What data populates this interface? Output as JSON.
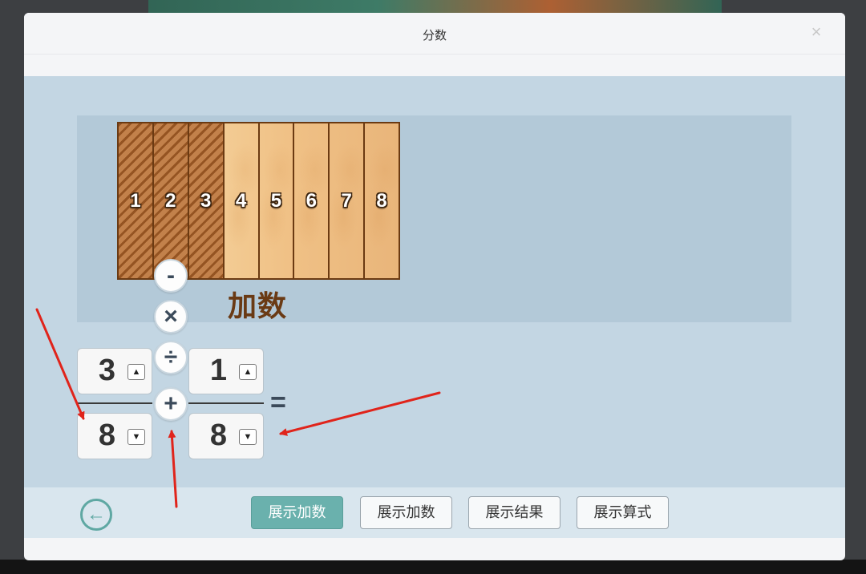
{
  "modal": {
    "title": "分数",
    "close_glyph": "×"
  },
  "bar": {
    "segments": [
      "1",
      "2",
      "3",
      "4",
      "5",
      "6",
      "7",
      "8"
    ],
    "shaded_count": 3,
    "label": "加数"
  },
  "operators": {
    "minus": "-",
    "times": "×",
    "divide": "÷",
    "plus": "+"
  },
  "fraction_left": {
    "numerator": "3",
    "denominator": "8"
  },
  "fraction_right": {
    "numerator": "1",
    "denominator": "8"
  },
  "spinner": {
    "up": "▲",
    "down": "▼"
  },
  "equals": "=",
  "footer": {
    "back_glyph": "←",
    "buttons": [
      "展示加数",
      "展示加数",
      "展示结果",
      "展示算式"
    ],
    "active_index": 0
  },
  "colors": {
    "accent": "#6ab1ad",
    "wood_dark": "#6b3a12",
    "annotation_arrow": "#e0241b"
  }
}
